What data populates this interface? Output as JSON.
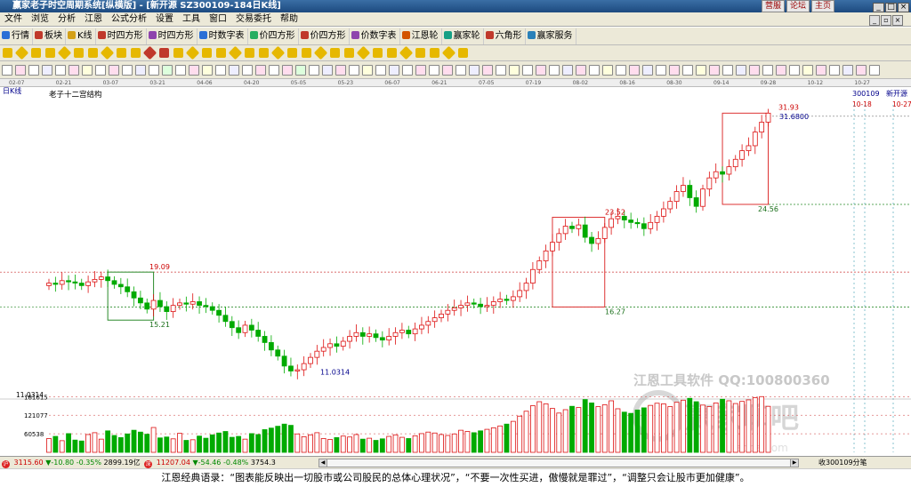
{
  "window": {
    "title": "赢家老子时空周期系统[纵横版] - [新开源  SZ300109-184日K线]",
    "links": [
      "营服",
      "论坛",
      "主页"
    ]
  },
  "menu": [
    "文件",
    "浏览",
    "分析",
    "江恩",
    "公式分析",
    "设置",
    "工具",
    "窗口",
    "交易委托",
    "帮助"
  ],
  "toolbar": [
    {
      "label": "行情",
      "color": "#2a6fd6"
    },
    {
      "label": "板块",
      "color": "#c0392b"
    },
    {
      "label": "K线",
      "color": "#d4a017"
    },
    {
      "label": "时四方形",
      "color": "#c0392b"
    },
    {
      "label": "时四方形",
      "color": "#8e44ad"
    },
    {
      "label": "时数字表",
      "color": "#2a6fd6"
    },
    {
      "label": "价四方形",
      "color": "#27ae60"
    },
    {
      "label": "价四方形",
      "color": "#c0392b"
    },
    {
      "label": "价数字表",
      "color": "#8e44ad"
    },
    {
      "label": "江恩轮",
      "color": "#d35400"
    },
    {
      "label": "赢家轮",
      "color": "#16a085"
    },
    {
      "label": "六角形",
      "color": "#c0392b"
    },
    {
      "label": "赢家服务",
      "color": "#2980b9"
    }
  ],
  "toolbar2_icons": [
    "#e6b800",
    "#e6b800",
    "#e6b800",
    "#e6b800",
    "#e6b800",
    "#e6b800",
    "#e6b800",
    "#e6b800",
    "#e6b800",
    "#e6b800",
    "#c0392b",
    "#c0392b",
    "#e6b800",
    "#e6b800",
    "#e6b800",
    "#e6b800",
    "#e6b800",
    "#e6b800",
    "#e6b800",
    "#e6b800",
    "#e6b800",
    "#e6b800",
    "#e6b800",
    "#e6b800",
    "#e6b800",
    "#e6b800",
    "#e6b800",
    "#e6b800",
    "#e6b800",
    "#e6b800",
    "#e6b800",
    "#e6b800",
    "#e6b800"
  ],
  "dates": [
    "02-07",
    "02-21",
    "03-07",
    "03-21",
    "04-06",
    "04-20",
    "05-05",
    "05-23",
    "06-07",
    "06-21",
    "07-05",
    "07-19",
    "08-02",
    "08-16",
    "08-30",
    "09-14",
    "09-28",
    "10-12",
    "10-27"
  ],
  "chart_data": {
    "type": "candlestick",
    "panel_label": "日K线",
    "title": "老子十二宫结构",
    "stock_code": "300109",
    "stock_name": "新开源",
    "header_dates": [
      "10-18",
      "10-27"
    ],
    "annotations": [
      "31.93",
      "31.6800",
      "24.56",
      "23.52",
      "16.27",
      "19.09",
      "15.21",
      "11.0314"
    ],
    "price_axis_label": "11.0314",
    "volume_ticks": [
      "181615",
      "121077",
      "60538"
    ],
    "watermark": [
      "江恩工具软件 QQ:100800360",
      "赢家聊吧",
      "jiaoba.com"
    ],
    "boxes": [
      {
        "high": 19.09,
        "low": 15.21
      },
      {
        "high": 23.52,
        "low": 16.27
      },
      {
        "high": 31.93,
        "low": 24.56
      }
    ],
    "close": [
      18.2,
      18.1,
      18.4,
      18.3,
      18.2,
      18.0,
      18.3,
      18.5,
      18.7,
      18.4,
      18.1,
      17.9,
      17.5,
      17.0,
      16.6,
      16.1,
      16.8,
      16.3,
      15.9,
      16.4,
      16.6,
      16.5,
      16.7,
      16.4,
      16.3,
      16.0,
      15.6,
      15.1,
      14.6,
      14.2,
      14.8,
      14.4,
      13.9,
      13.4,
      12.8,
      12.3,
      11.5,
      11.1,
      11.2,
      11.7,
      12.2,
      12.7,
      13.0,
      13.3,
      13.1,
      13.5,
      13.9,
      14.2,
      13.9,
      14.1,
      13.8,
      13.6,
      13.9,
      14.2,
      14.4,
      14.1,
      14.5,
      14.8,
      15.1,
      15.4,
      15.7,
      16.0,
      16.2,
      16.4,
      16.6,
      16.5,
      16.3,
      16.4,
      16.7,
      16.9,
      16.8,
      17.1,
      17.6,
      18.2,
      19.3,
      20.0,
      20.8,
      21.5,
      22.2,
      22.8,
      22.6,
      22.9,
      21.9,
      21.4,
      21.8,
      22.7,
      23.4,
      23.6,
      23.3,
      23.1,
      23.0,
      22.6,
      23.1,
      23.6,
      24.2,
      24.8,
      25.6,
      26.1,
      25.1,
      24.4,
      25.8,
      26.7,
      27.2,
      27.0,
      27.6,
      28.2,
      28.9,
      29.3,
      30.4,
      31.2,
      31.93
    ],
    "volume": [
      45000,
      52000,
      38000,
      61000,
      40000,
      37000,
      58000,
      64000,
      43000,
      70000,
      55000,
      48000,
      60000,
      72000,
      66000,
      59000,
      81000,
      47000,
      50000,
      44000,
      62000,
      39000,
      41000,
      53000,
      46000,
      57000,
      63000,
      68000,
      49000,
      52000,
      43000,
      61000,
      58000,
      74000,
      79000,
      85000,
      92000,
      88000,
      60000,
      51000,
      57000,
      64000,
      45000,
      42000,
      48000,
      53000,
      50000,
      58000,
      43000,
      46000,
      39000,
      44000,
      52000,
      57000,
      49000,
      45000,
      54000,
      61000,
      66000,
      63000,
      58000,
      55000,
      60000,
      72000,
      68000,
      64000,
      70000,
      75000,
      80000,
      86000,
      92000,
      101000,
      118000,
      134000,
      152000,
      165000,
      158000,
      143000,
      128000,
      139000,
      150000,
      146000,
      172000,
      161000,
      149000,
      155000,
      168000,
      142000,
      131000,
      127000,
      138000,
      145000,
      153000,
      160000,
      158000,
      149000,
      163000,
      170000,
      176000,
      165000,
      154000,
      149000,
      161000,
      173000,
      168000,
      159000,
      166000,
      171000,
      178000,
      181615,
      150000
    ]
  },
  "status": {
    "idx1_value": "3115.60",
    "idx1_change": "▼-10.80",
    "idx1_pct": "-0.35%",
    "idx1_amount": "2899.19亿",
    "idx2_value": "11207.04",
    "idx2_change": "▼-54.46",
    "idx2_pct": "-0.48%",
    "idx2_amount": "3754.3",
    "right_text": "收300109分笔"
  },
  "quote": "江恩经典语录：“图表能反映出一切股市或公司股民的总体心理状况”，“不要一次性买进，傲慢就是罪过”，“调整只会让股市更加健康”。"
}
